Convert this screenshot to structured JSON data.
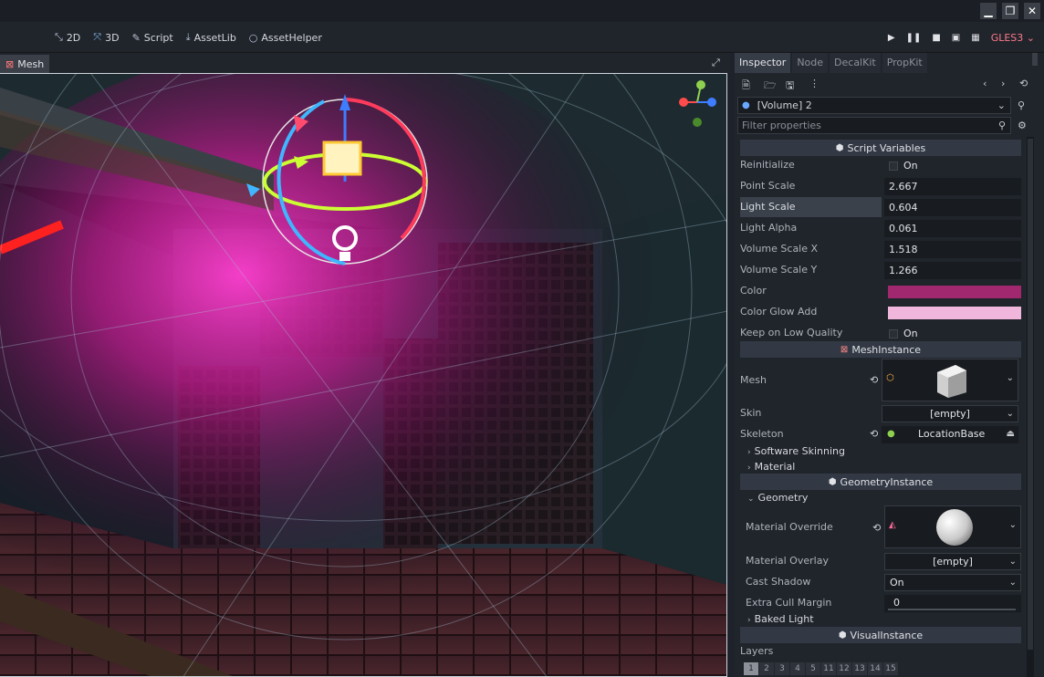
{
  "window": {
    "minimize_icon": "minimize-icon",
    "maximize_icon": "maximize-icon",
    "close_icon": "close-icon"
  },
  "toolbar": {
    "modes": [
      {
        "label": "2D",
        "icon": "2d-icon"
      },
      {
        "label": "3D",
        "icon": "3d-icon"
      },
      {
        "label": "Script",
        "icon": "script-icon"
      },
      {
        "label": "AssetLib",
        "icon": "assetlib-icon"
      },
      {
        "label": "AssetHelper",
        "icon": "assethelper-icon"
      }
    ],
    "renderer": "GLES3"
  },
  "viewport": {
    "tab_label": "Mesh"
  },
  "inspector": {
    "tabs": [
      "Inspector",
      "Node",
      "DecalKit",
      "PropKit"
    ],
    "object_label": "[Volume] 2",
    "filter_placeholder": "Filter properties",
    "script_variables": {
      "header": "Script Variables",
      "props": [
        {
          "label": "Reinitialize",
          "value": "On",
          "type": "check"
        },
        {
          "label": "Point Scale",
          "value": "2.667"
        },
        {
          "label": "Light Scale",
          "value": "0.604"
        },
        {
          "label": "Light Alpha",
          "value": "0.061"
        },
        {
          "label": "Volume Scale X",
          "value": "1.518"
        },
        {
          "label": "Volume Scale Y",
          "value": "1.266"
        },
        {
          "label": "Color",
          "color": "#a1276f"
        },
        {
          "label": "Color Glow Add",
          "color": "#f1b6dc"
        },
        {
          "label": "Keep on Low Quality",
          "value": "On",
          "type": "check"
        }
      ]
    },
    "mesh_instance": {
      "header": "MeshInstance",
      "mesh_label": "Mesh",
      "skin_label": "Skin",
      "skin_value": "[empty]",
      "skeleton_label": "Skeleton",
      "skeleton_value": "LocationBase",
      "software_skinning": "Software Skinning",
      "material": "Material"
    },
    "geometry_instance": {
      "header": "GeometryInstance",
      "geometry": "Geometry",
      "material_override_label": "Material Override",
      "material_overlay_label": "Material Overlay",
      "material_overlay_value": "[empty]",
      "cast_shadow_label": "Cast Shadow",
      "cast_shadow_value": "On",
      "extra_cull_label": "Extra Cull Margin",
      "extra_cull_value": "0",
      "baked_light": "Baked Light"
    },
    "visual_instance": {
      "header": "VisualInstance",
      "layers_label": "Layers",
      "layers": [
        "1",
        "2",
        "3",
        "4",
        "5",
        "11",
        "12",
        "13",
        "14",
        "15"
      ]
    }
  }
}
